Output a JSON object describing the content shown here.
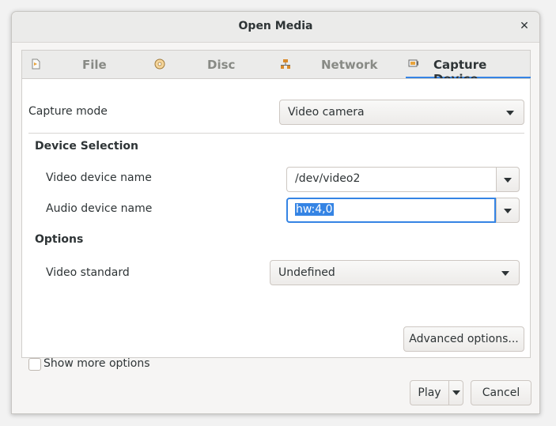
{
  "window": {
    "title": "Open Media",
    "close_glyph": "✕"
  },
  "tabs": [
    {
      "label": "File",
      "icon": "file-icon",
      "active": false
    },
    {
      "label": "Disc",
      "icon": "disc-icon",
      "active": false
    },
    {
      "label": "Network",
      "icon": "network-icon",
      "active": false
    },
    {
      "label": "Capture Device",
      "icon": "capture-device-icon",
      "active": true
    }
  ],
  "capture": {
    "mode_label": "Capture mode",
    "mode_value": "Video camera"
  },
  "device_selection": {
    "heading": "Device Selection",
    "video_label": "Video device name",
    "video_value": "/dev/video2",
    "audio_label": "Audio device name",
    "audio_value": "hw:4,0"
  },
  "options": {
    "heading": "Options",
    "standard_label": "Video standard",
    "standard_value": "Undefined"
  },
  "buttons": {
    "advanced": "Advanced options...",
    "play": "Play",
    "cancel": "Cancel"
  },
  "show_more": {
    "label": "Show more options",
    "checked": false
  },
  "colors": {
    "accent": "#3584e4",
    "background": "#f6f5f4"
  }
}
